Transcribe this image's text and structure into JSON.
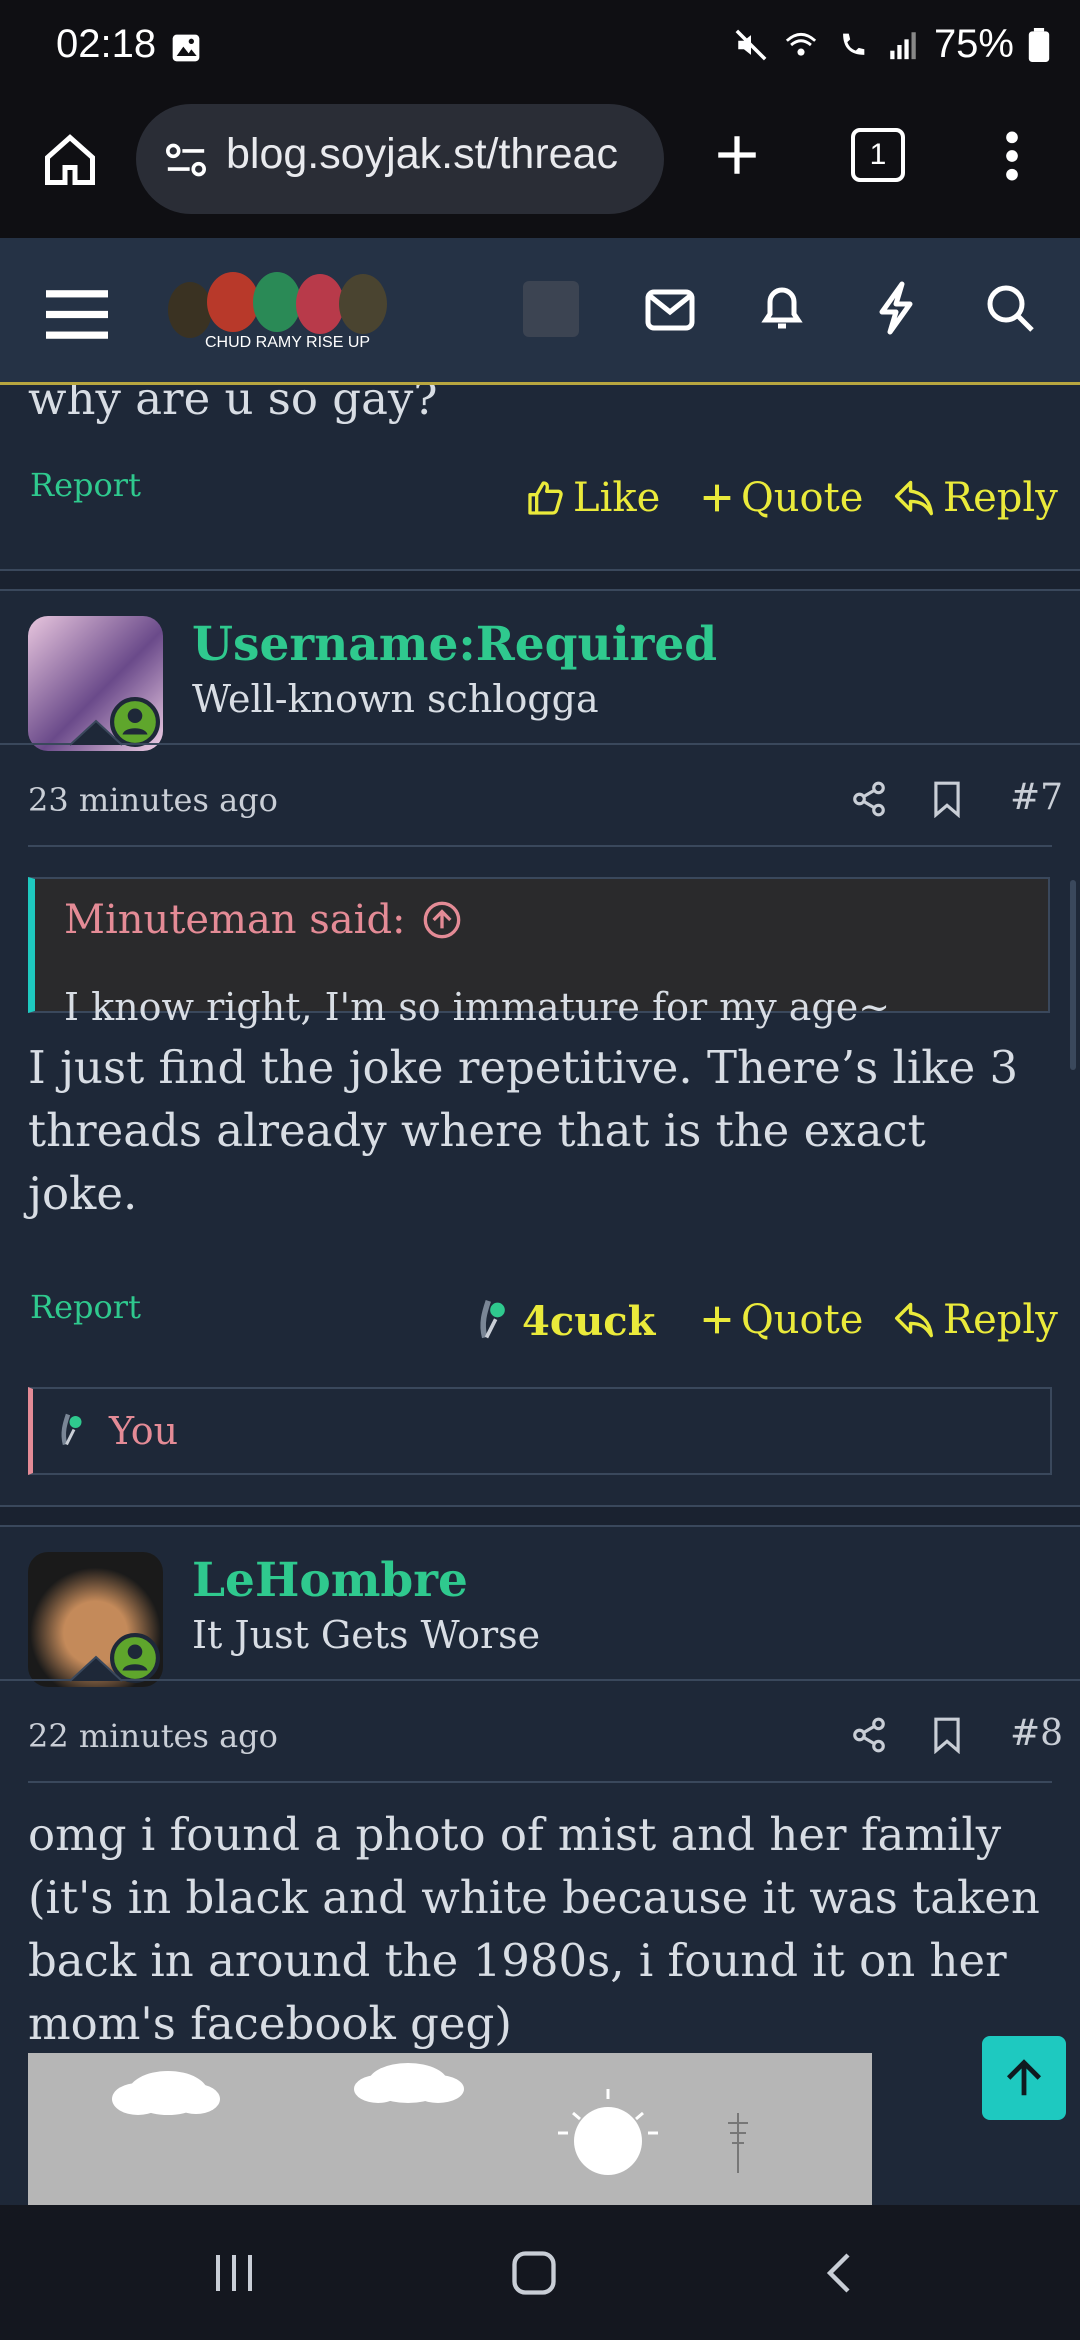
{
  "status": {
    "time": "02:18",
    "battery": "75%"
  },
  "browser": {
    "url": "blog.soyjak.st/threac",
    "tab_count": "1"
  },
  "forum": {
    "logo_text": "CHUD RAMY RISE UP"
  },
  "prev_post": {
    "text_tail": "why are u so gay?",
    "report": "Report",
    "like": "Like",
    "quote": "Quote",
    "reply": "Reply"
  },
  "post7": {
    "username": "Username:Required",
    "user_title": "Well-known schlogga",
    "time": "23 minutes ago",
    "number": "#7",
    "quote_author": "Minuteman said:",
    "quote_text": "I know right, I'm so immature for my age~",
    "body": "I just find the joke repetitive. There’s like 3 threads already where that is the exact joke.",
    "report": "Report",
    "reaction": "4cuck",
    "quote": "Quote",
    "reply": "Reply",
    "reacted_by": "You"
  },
  "post8": {
    "username": "LeHombre",
    "user_title": "It Just Gets Worse",
    "time": "22 minutes ago",
    "number": "#8",
    "body": "omg i found a photo of mist and her family (it's in black and white because it was taken back in around the 1980s, i found it on her mom's facebook geg)"
  },
  "colors": {
    "accent": "#2fc98e",
    "link_yellow": "#eaea3b",
    "scroll_top": "#1ec9c0"
  }
}
